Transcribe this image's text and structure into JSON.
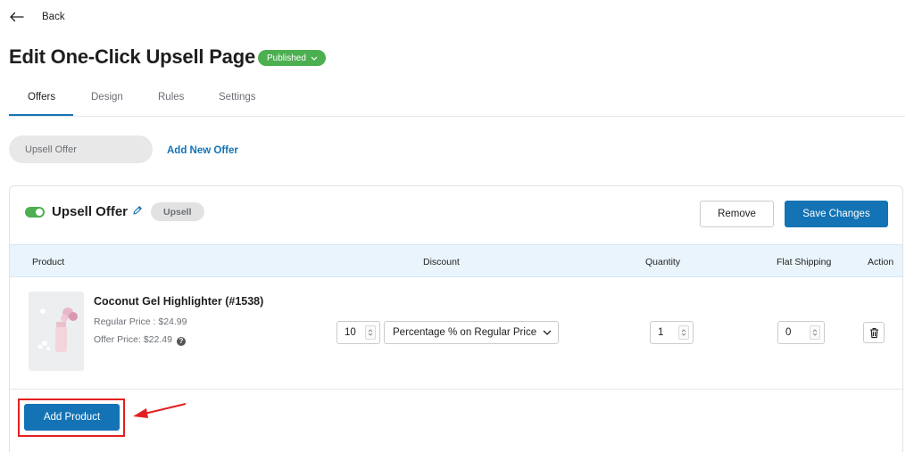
{
  "header": {
    "back_label": "Back",
    "page_title": "Edit One-Click Upsell Page",
    "status_label": "Published"
  },
  "tabs": [
    {
      "label": "Offers",
      "active": true
    },
    {
      "label": "Design",
      "active": false
    },
    {
      "label": "Rules",
      "active": false
    },
    {
      "label": "Settings",
      "active": false
    }
  ],
  "offers_bar": {
    "offer_pill_label": "Upsell Offer",
    "add_new_offer_label": "Add New Offer"
  },
  "offer_card": {
    "enabled": true,
    "title": "Upsell Offer",
    "type_badge": "Upsell",
    "remove_label": "Remove",
    "save_label": "Save Changes",
    "columns": {
      "product": "Product",
      "discount": "Discount",
      "quantity": "Quantity",
      "flat_shipping": "Flat Shipping",
      "action": "Action"
    },
    "product": {
      "name": "Coconut Gel Highlighter (#1538)",
      "regular_price": "Regular Price : $24.99",
      "offer_price": "Offer Price: $22.49",
      "discount_value": "10",
      "discount_type": "Percentage % on Regular Price",
      "quantity": "1",
      "flat_shipping": "0"
    },
    "add_product_label": "Add Product"
  },
  "icons": {
    "back": "arrow-left-icon",
    "status_dropdown": "chevron-down-icon",
    "edit": "pencil-icon",
    "help": "question-circle-icon",
    "spinner": "up-down-arrows-icon",
    "select_dropdown": "chevron-down-icon",
    "delete": "trash-icon",
    "annotation": "red-arrow-icon"
  },
  "colors": {
    "accent": "#1473b5",
    "published": "#4caf50",
    "annotation": "#e32020",
    "table_header_bg": "#eaf4fc"
  }
}
